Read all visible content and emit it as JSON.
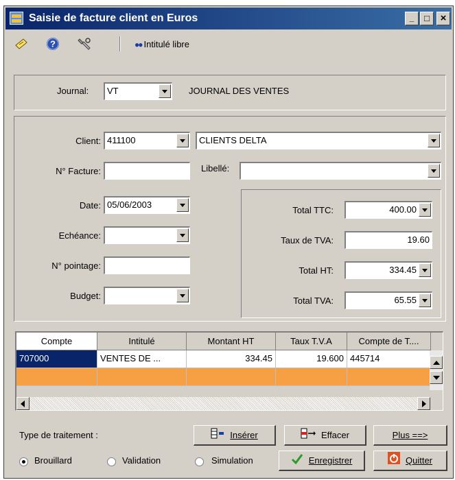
{
  "window": {
    "title": "Saisie de facture client en Euros",
    "controls": {
      "minimize": "_",
      "maximize": "□",
      "close": "×"
    }
  },
  "toolbar": {
    "icons": [
      "note-icon",
      "help-icon",
      "tools-icon"
    ],
    "link_label": "Intitulé libre",
    "link_icon": "eyes-icon",
    "link_glyph": "●●"
  },
  "journal": {
    "label": "Journal:",
    "code": "VT",
    "name": "JOURNAL DES VENTES"
  },
  "form": {
    "client_label": "Client:",
    "client_code": "411100",
    "client_name": "CLIENTS DELTA",
    "invoice_label": "N° Facture:",
    "invoice_value": "",
    "libelle_label": "Libellé:",
    "libelle_value": "",
    "date_label": "Date:",
    "date_value": "05/06/2003",
    "echeance_label": "Echéance:",
    "echeance_value": "",
    "pointage_label": "N° pointage:",
    "pointage_value": "",
    "budget_label": "Budget:",
    "budget_value": ""
  },
  "totals": {
    "ttc_label": "Total TTC:",
    "ttc_value": "400.00",
    "tva_rate_label": "Taux de TVA:",
    "tva_rate_value": "19.60",
    "ht_label": "Total HT:",
    "ht_value": "334.45",
    "tva_label": "Total TVA:",
    "tva_value": "65.55"
  },
  "grid": {
    "columns": [
      "Compte",
      "Intitulé",
      "Montant HT",
      "Taux T.V.A",
      "Compte de T...."
    ],
    "rows": [
      [
        "707000",
        "VENTES DE ...",
        "334.45",
        "19.600",
        "445714"
      ]
    ]
  },
  "actions": {
    "type_label": "Type de traitement :",
    "insert": "Insérer",
    "delete": "Effacer",
    "more": "Plus ==>",
    "save": "Enregistrer",
    "quit": "Quitter"
  },
  "mode": {
    "options": [
      "Brouillard",
      "Validation",
      "Simulation"
    ],
    "selected": "Brouillard"
  },
  "colors": {
    "titlebar_start": "#0a246a",
    "titlebar_end": "#3a6ea5",
    "selection": "#0a246a",
    "new_row": "#f7a043",
    "face": "#d4d0c8"
  }
}
